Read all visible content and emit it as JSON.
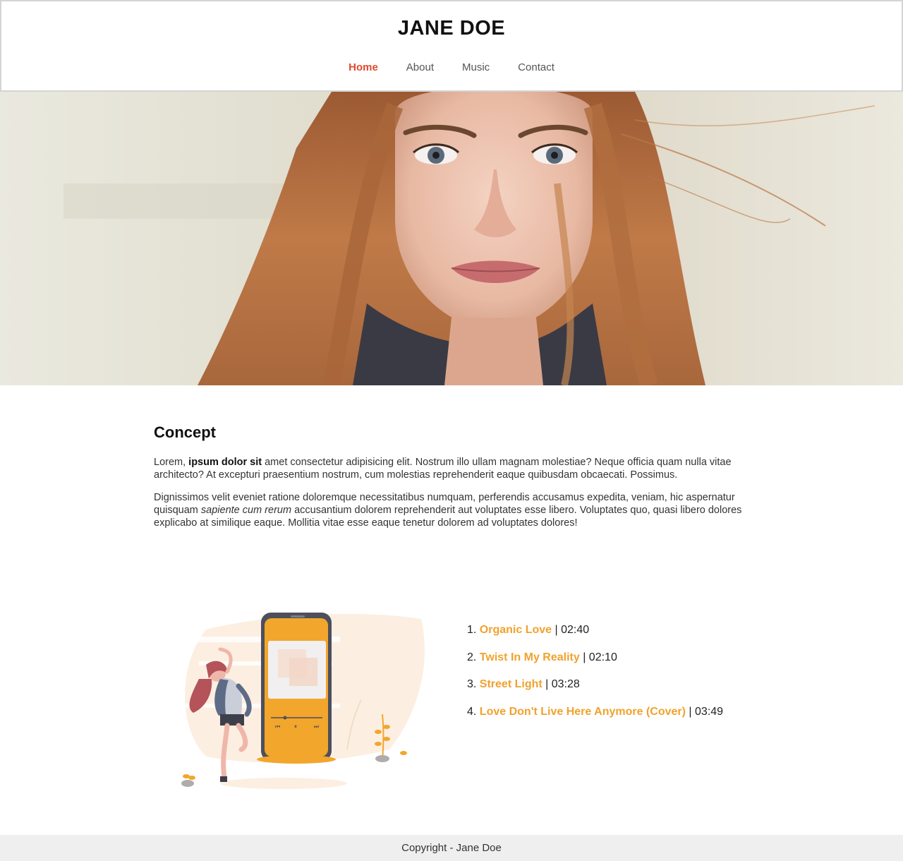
{
  "header": {
    "title": "JANE DOE",
    "nav": [
      "Home",
      "About",
      "Music",
      "Contact"
    ]
  },
  "hero": {
    "image": "portrait-photo"
  },
  "concept": {
    "heading": "Concept",
    "p1_start": "Lorem, ",
    "p1_bold": "ipsum dolor sit",
    "p1_end": " amet consectetur adipisicing elit. Nostrum illo ullam magnam molestiae? Neque officia quam nulla vitae architecto? At excepturi praesentium nostrum, cum molestias reprehenderit eaque quibusdam obcaecati. Possimus.",
    "p2_start": "Dignissimos velit eveniet ratione doloremque necessitatibus numquam, perferendis accusamus expedita, veniam, hic aspernatur quisquam ",
    "p2_italic": "sapiente cum rerum",
    "p2_end": " accusantium dolorem reprehenderit aut voluptates esse libero. Voluptates quo, quasi libero dolores explicabo at similique eaque. Mollitia vitae esse eaque tenetur dolorem ad voluptates dolores!"
  },
  "music": {
    "illustration": "music-player-illustration",
    "tracks": [
      {
        "number": "1.",
        "title": "Organic Love",
        "duration": " | 02:40"
      },
      {
        "number": "2.",
        "title": "Twist In My Reality",
        "duration": " | 02:10"
      },
      {
        "number": "3.",
        "title": "Street Light",
        "duration": " | 03:28"
      },
      {
        "number": "4.",
        "title": "Love Don't Live Here Anymore (Cover)",
        "duration": " | 03:49"
      }
    ]
  },
  "footer": {
    "copyright": "Copyright - Jane Doe"
  },
  "colors": {
    "accent": "#f0a22d",
    "nav_active": "#e04a2f",
    "footer_bg": "#efefef"
  }
}
